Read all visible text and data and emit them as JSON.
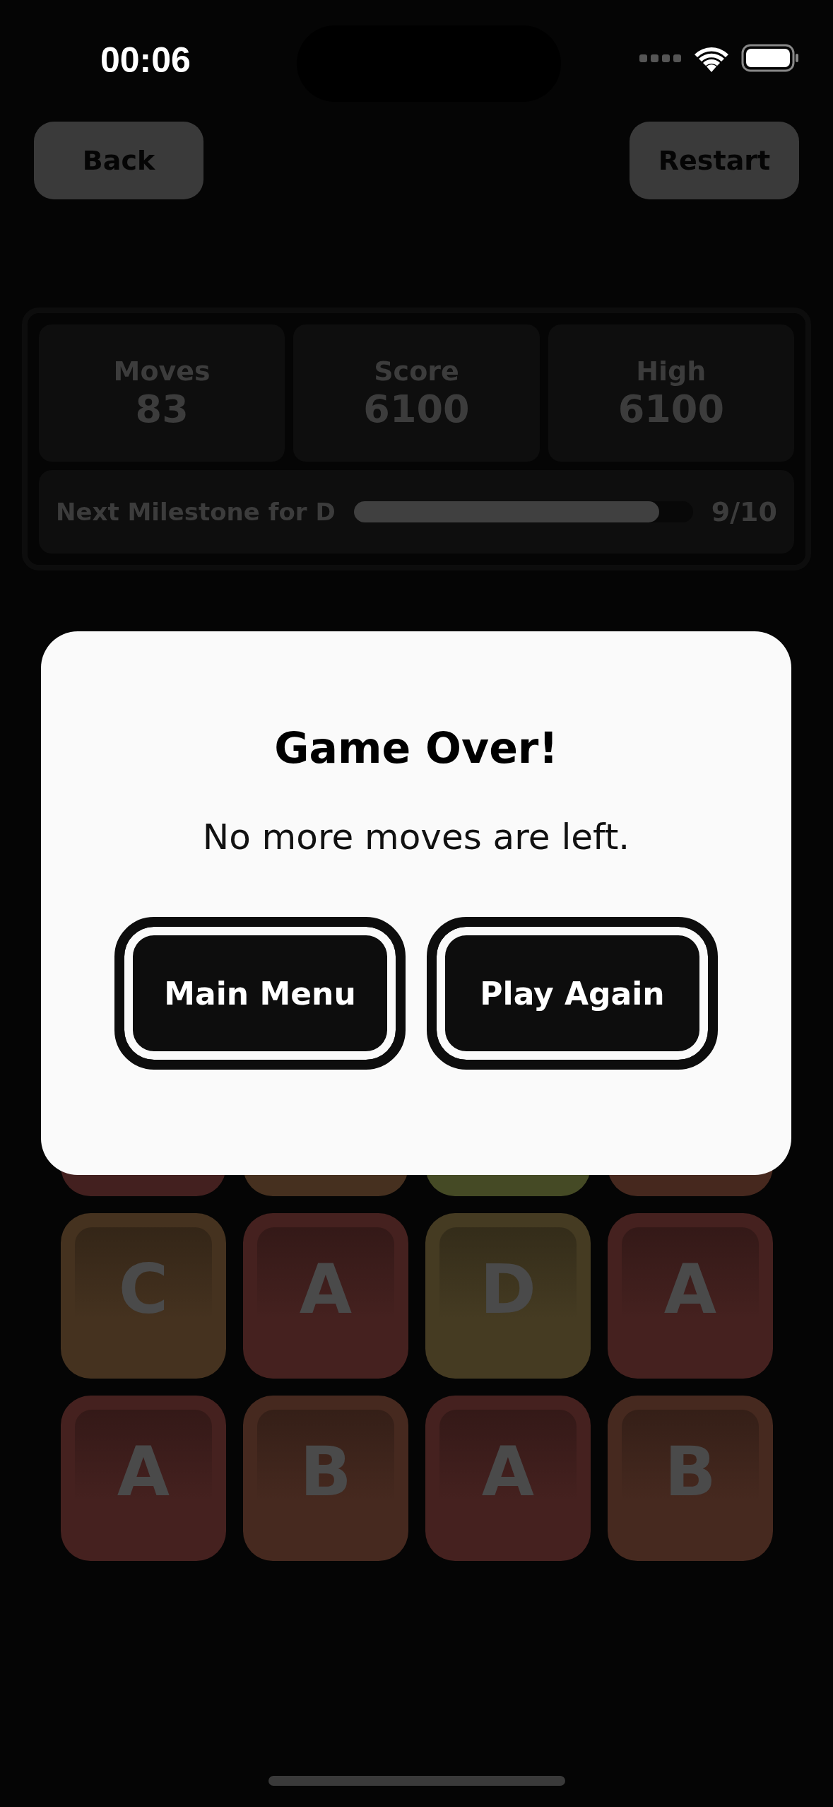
{
  "status_bar": {
    "time": "00:06"
  },
  "top_buttons": [
    "Back",
    "Restart"
  ],
  "stats": [
    {
      "label": "Moves",
      "value": "83"
    },
    {
      "label": "Score",
      "value": "6100"
    },
    {
      "label": "High",
      "value": "6100"
    }
  ],
  "milestone": {
    "label": "Next Milestone for D",
    "level": 0.9,
    "reading": "9/10"
  },
  "tiles": [
    {
      "color": "#43201f"
    },
    {
      "color": "#46301f"
    },
    {
      "color": "#454a25"
    },
    {
      "color": "#46281e"
    },
    {
      "letter": "C",
      "color": "#45321f"
    },
    {
      "letter": "A",
      "color": "#45211f"
    },
    {
      "letter": "D",
      "color": "#453b22"
    },
    {
      "letter": "A",
      "color": "#45211f"
    },
    {
      "letter": "A",
      "color": "#45211f"
    },
    {
      "letter": "B",
      "color": "#46291f"
    },
    {
      "letter": "A",
      "color": "#45211f"
    },
    {
      "letter": "B",
      "color": "#46291f"
    }
  ],
  "dialog": {
    "title": "Game Over!",
    "message": "No more moves are left.",
    "buttons": [
      "Main Menu",
      "Play Again"
    ]
  }
}
